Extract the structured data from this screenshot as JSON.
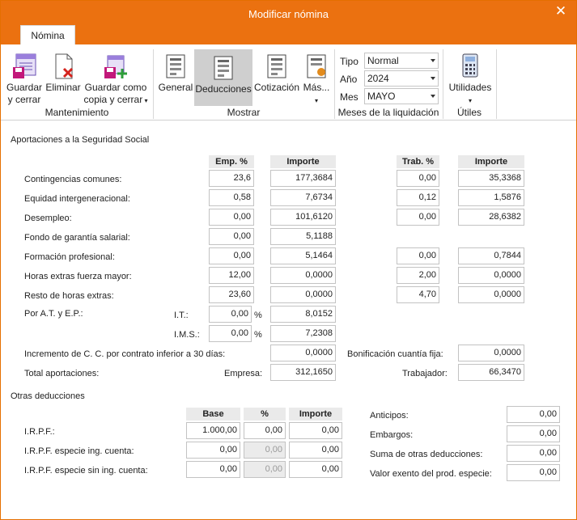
{
  "window": {
    "title": "Modificar nómina",
    "close_glyph": "✕",
    "tab": "Nómina"
  },
  "ribbon": {
    "buttons": {
      "guardar": "Guardar y cerrar",
      "eliminar": "Eliminar",
      "guardar_copia": "Guardar como copia y cerrar",
      "general": "General",
      "deducciones": "Deducciones",
      "cotizacion": "Cotización",
      "mas": "Más..."
    },
    "groups": {
      "mantenimiento": "Mantenimiento",
      "mostrar": "Mostrar",
      "meses": "Meses de la liquidación",
      "utiles": "Útiles"
    },
    "tipo": {
      "label": "Tipo",
      "value": "Normal"
    },
    "anio": {
      "label": "Año",
      "value": "2024"
    },
    "mes": {
      "label": "Mes",
      "value": "MAYO"
    },
    "utilidades": "Utilidades"
  },
  "aportaciones": {
    "title": "Aportaciones a la Seguridad Social",
    "headers": {
      "emp": "Emp. %",
      "importe1": "Importe",
      "trab": "Trab. %",
      "importe2": "Importe"
    },
    "rows": [
      {
        "label": "Contingencias comunes:",
        "emp": "23,6",
        "imp1": "177,3684",
        "trab": "0,00",
        "imp2": "35,3368"
      },
      {
        "label": "Equidad intergeneracional:",
        "emp": "0,58",
        "imp1": "7,6734",
        "trab": "0,12",
        "imp2": "1,5876"
      },
      {
        "label": "Desempleo:",
        "emp": "0,00",
        "imp1": "101,6120",
        "trab": "0,00",
        "imp2": "28,6382"
      },
      {
        "label": "Fondo de garantía salarial:",
        "emp": "0,00",
        "imp1": "5,1188"
      },
      {
        "label": "Formación profesional:",
        "emp": "0,00",
        "imp1": "5,1464",
        "trab": "0,00",
        "imp2": "0,7844"
      },
      {
        "label": "Horas extras fuerza mayor:",
        "emp": "12,00",
        "imp1": "0,0000",
        "trab": "2,00",
        "imp2": "0,0000"
      },
      {
        "label": "Resto de horas extras:",
        "emp": "23,60",
        "imp1": "0,0000",
        "trab": "4,70",
        "imp2": "0,0000"
      }
    ],
    "atep": {
      "label": "Por A.T. y E.P.:",
      "it_label": "I.T.:",
      "it_pct": "0,00",
      "it_imp": "8,0152",
      "ims_label": "I.M.S.:",
      "ims_pct": "0,00",
      "ims_imp": "7,2308",
      "pct_sign": "%"
    },
    "incremento": {
      "label": "Incremento de C. C. por contrato inferior a 30 días:",
      "value": "0,0000"
    },
    "bonificacion": {
      "label": "Bonificación cuantía fija:",
      "value": "0,0000"
    },
    "total": {
      "label": "Total aportaciones:",
      "empresa_label": "Empresa:",
      "empresa": "312,1650",
      "trabajador_label": "Trabajador:",
      "trabajador": "66,3470"
    }
  },
  "otras": {
    "title": "Otras deducciones",
    "headers": {
      "base": "Base",
      "pct": "%",
      "importe": "Importe"
    },
    "rows": [
      {
        "label": "I.R.P.F.:",
        "base": "1.000,00",
        "pct": "0,00",
        "imp": "0,00"
      },
      {
        "label": "I.R.P.F. especie ing. cuenta:",
        "base": "0,00",
        "pct": "0,00",
        "imp": "0,00"
      },
      {
        "label": "I.R.P.F. especie sin ing. cuenta:",
        "base": "0,00",
        "pct": "0,00",
        "imp": "0,00"
      }
    ],
    "right": [
      {
        "label": "Anticipos:",
        "value": "0,00"
      },
      {
        "label": "Embargos:",
        "value": "0,00"
      },
      {
        "label": "Suma de otras deducciones:",
        "value": "0,00"
      },
      {
        "label": "Valor exento del prod. especie:",
        "value": "0,00"
      }
    ]
  }
}
